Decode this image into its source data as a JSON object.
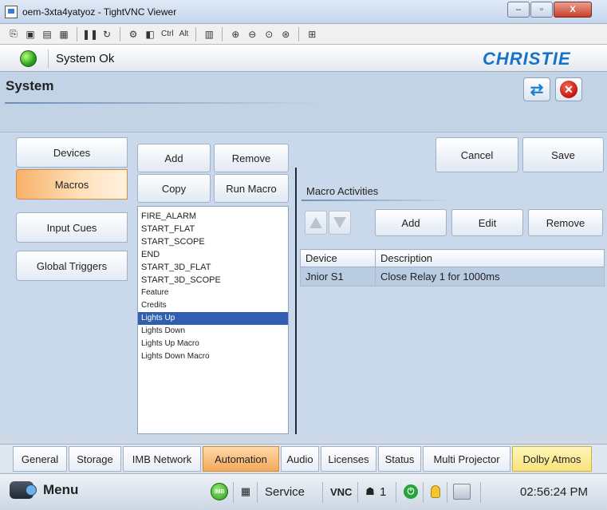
{
  "window": {
    "title": "oem-3xta4yatyoz - TightVNC Viewer",
    "min_glyph": "–",
    "max_glyph": "▫",
    "close_glyph": "X"
  },
  "vnc_toolbar": {
    "ctrl_label": "Ctrl",
    "alt_label": "Alt"
  },
  "header": {
    "status_text": "System Ok",
    "brand": "CHRISTIE",
    "status_color": "#2aa21a",
    "brand_color": "#1474c9"
  },
  "section": {
    "title": "System",
    "refresh_icon": "refresh-icon",
    "close_icon": "close-circle-icon"
  },
  "left_tabs": [
    {
      "label": "Devices",
      "active": false
    },
    {
      "label": "Macros",
      "active": true
    },
    {
      "label": "Input Cues",
      "active": false
    },
    {
      "label": "Global Triggers",
      "active": false
    }
  ],
  "macro_buttons": {
    "add": "Add",
    "remove": "Remove",
    "copy": "Copy",
    "run": "Run Macro"
  },
  "macros": [
    {
      "name": "FIRE_ALARM",
      "selected": false
    },
    {
      "name": "START_FLAT",
      "selected": false
    },
    {
      "name": "START_SCOPE",
      "selected": false
    },
    {
      "name": "END",
      "selected": false
    },
    {
      "name": "START_3D_FLAT",
      "selected": false
    },
    {
      "name": "START_3D_SCOPE",
      "selected": false
    },
    {
      "name": "Feature",
      "selected": false
    },
    {
      "name": "Credits",
      "selected": false
    },
    {
      "name": "Lights Up",
      "selected": true
    },
    {
      "name": "Lights Down",
      "selected": false
    },
    {
      "name": "Lights Up Macro",
      "selected": false
    },
    {
      "name": "Lights Down Macro",
      "selected": false
    }
  ],
  "actions": {
    "cancel": "Cancel",
    "save": "Save"
  },
  "activities": {
    "label": "Macro Activities",
    "add": "Add",
    "edit": "Edit",
    "remove": "Remove",
    "columns": [
      "Device",
      "Description"
    ],
    "rows": [
      {
        "device": "Jnior S1",
        "description": "Close Relay 1 for 1000ms"
      }
    ]
  },
  "bottom_tabs": [
    {
      "label": "General",
      "active": false
    },
    {
      "label": "Storage",
      "active": false
    },
    {
      "label": "IMB Network",
      "active": false
    },
    {
      "label": "Automation",
      "active": true
    },
    {
      "label": "Audio",
      "active": false
    },
    {
      "label": "Licenses",
      "active": false
    },
    {
      "label": "Status",
      "active": false
    },
    {
      "label": "Multi Projector",
      "active": false
    },
    {
      "label": "Dolby Atmos",
      "active": false
    }
  ],
  "statusbar": {
    "menu": "Menu",
    "imb_label": "IMB",
    "service": "Service",
    "vnc": "VNC",
    "session_count": "1",
    "time": "02:56:24 PM"
  }
}
